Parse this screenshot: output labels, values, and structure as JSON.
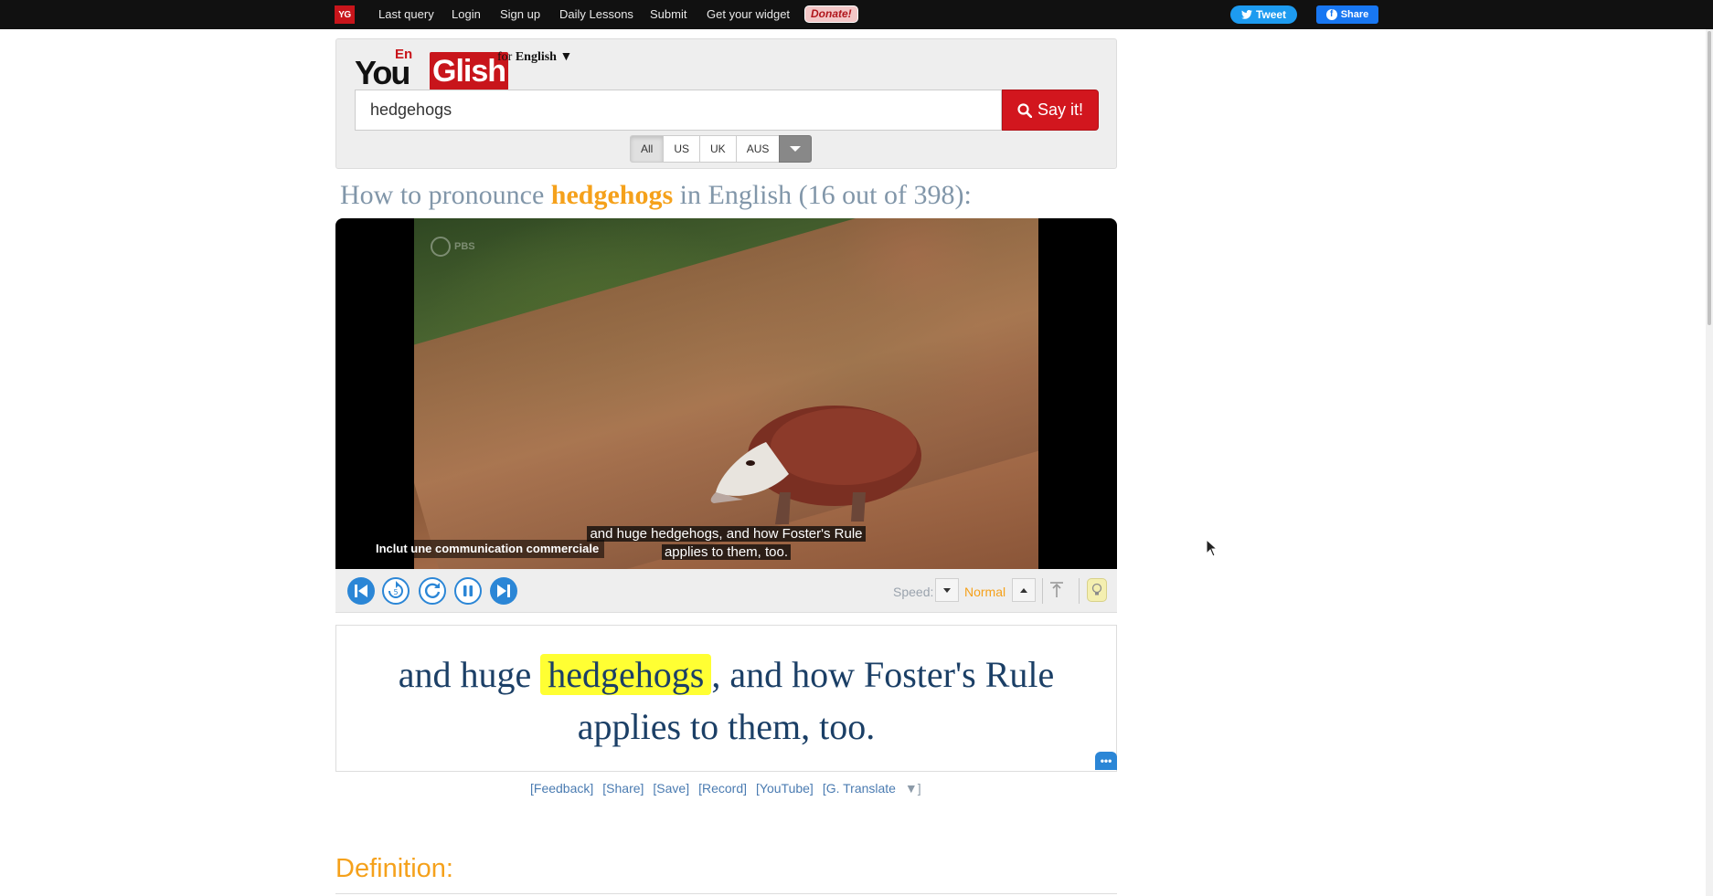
{
  "nav": {
    "logo": "YG",
    "links": [
      "Last query",
      "Login",
      "Sign up",
      "Daily Lessons",
      "Submit",
      "Get your widget"
    ],
    "donate": "Donate!",
    "tweet": "Tweet",
    "share": "Share"
  },
  "brand": {
    "you": "You",
    "en": "En",
    "glish": "Glish",
    "for_prefix": "for",
    "language": "English",
    "language_caret": "▼"
  },
  "search": {
    "value": "hedgehogs",
    "button": "Say it!"
  },
  "accents": {
    "options": [
      "All",
      "US",
      "UK",
      "AUS"
    ],
    "selected": "All"
  },
  "heading": {
    "prefix": "How to pronounce",
    "word": "hedgehogs",
    "suffix": "in English (16 out of 398):"
  },
  "video": {
    "watermark": "PBS",
    "ad_notice": "Inclut une communication commerciale",
    "caption_line1": "and huge hedgehogs, and how Foster's Rule",
    "caption_line2": "applies to them, too."
  },
  "controls": {
    "speed_label": "Speed:",
    "speed_value": "Normal"
  },
  "transcript": {
    "before": "and huge",
    "word": "hedgehogs",
    "after_line1": ", and how Foster's Rule",
    "line2": "applies to them, too.",
    "more": "•••"
  },
  "actions": [
    "[Feedback]",
    "[Share]",
    "[Save]",
    "[Record]",
    "[YouTube]",
    "[G. Translate"
  ],
  "actions_caret": "▼]",
  "definition": "Definition:",
  "colors": {
    "accent_orange": "#f5a11b",
    "brand_red": "#c8151b",
    "link_blue": "#4a7bb1",
    "caption_navy": "#1b3f66",
    "highlight_yellow": "#ffff33"
  }
}
